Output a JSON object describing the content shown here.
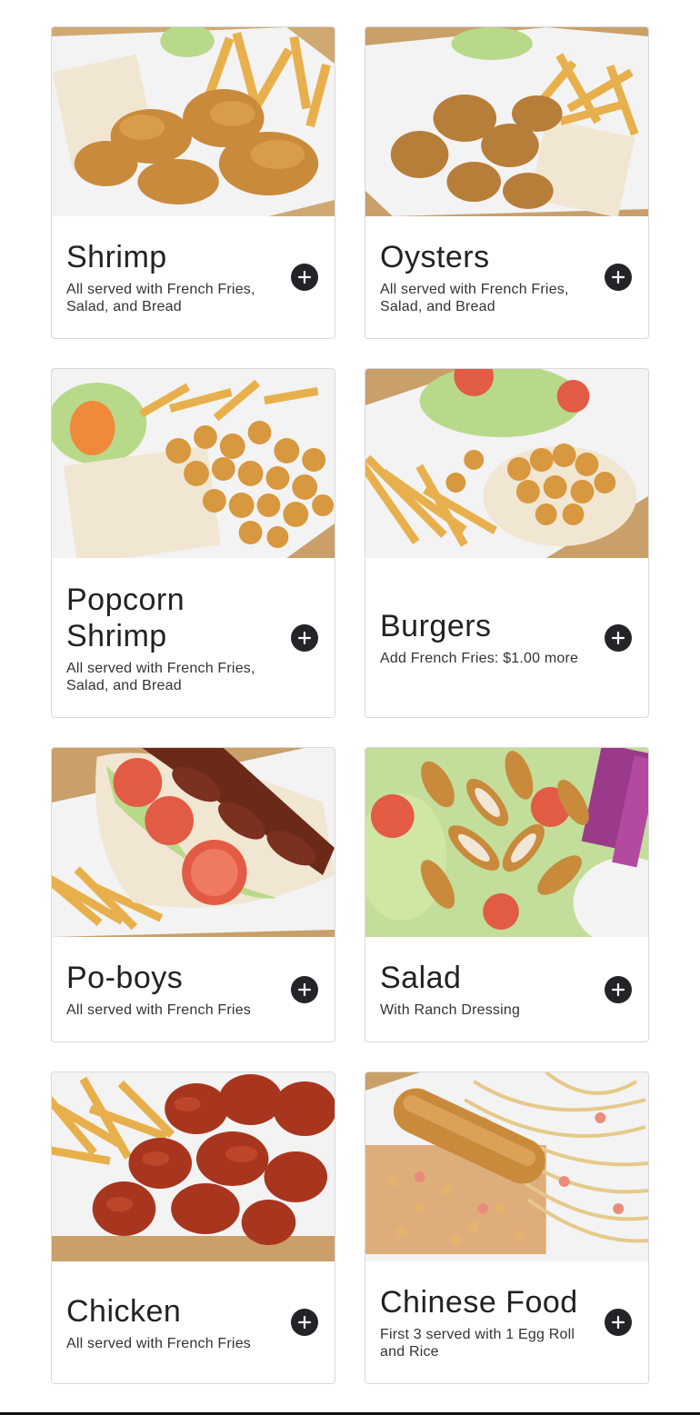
{
  "menu": {
    "items": [
      {
        "name": "Shrimp",
        "description": "All served with French Fries, Salad, and Bread",
        "image_icon": "fried-shrimp-platter-image"
      },
      {
        "name": "Oysters",
        "description": "All served with French Fries, Salad, and Bread",
        "image_icon": "fried-oysters-platter-image"
      },
      {
        "name": "Popcorn Shrimp",
        "description": "All served with French Fries, Salad, and Bread",
        "image_icon": "popcorn-shrimp-platter-image"
      },
      {
        "name": "Burgers",
        "description": "Add French Fries: $1.00 more",
        "image_icon": "shrimp-burger-image"
      },
      {
        "name": "Po-boys",
        "description": "All served with French Fries",
        "image_icon": "sausage-po-boy-image"
      },
      {
        "name": "Salad",
        "description": "With Ranch Dressing",
        "image_icon": "chicken-salad-image"
      },
      {
        "name": "Chicken",
        "description": "All served with French Fries",
        "image_icon": "chicken-wings-image"
      },
      {
        "name": "Chinese Food",
        "description": "First 3 served with 1 Egg Roll and Rice",
        "image_icon": "lo-mein-egg-roll-image"
      }
    ],
    "add_icon": "plus-icon"
  },
  "colors": {
    "button": "#222427",
    "border": "#d9d9d9",
    "fries": "#e8b04c",
    "fried": "#c98a3c",
    "sauce": "#a8361f",
    "lettuce": "#b9d98a",
    "tomato": "#e25b45",
    "bread": "#f1e6d2",
    "container": "#f3f3f3",
    "wood": "#c9a06a"
  }
}
